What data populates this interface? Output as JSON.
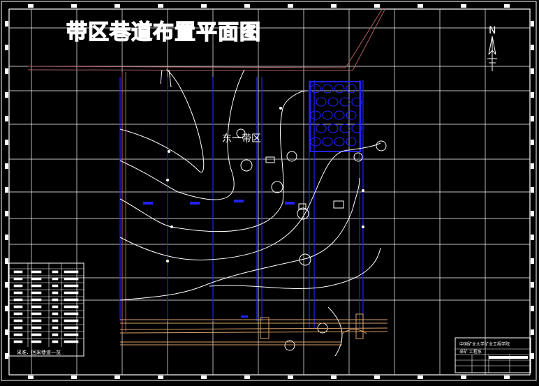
{
  "drawing": {
    "title": "带区巷道布置平面图",
    "zone_label": "东一带区",
    "north_label": "N"
  },
  "title_block": {
    "line1": "中国矿业大学矿业工程学院",
    "line2": "采矿 工程系"
  },
  "legend": {
    "caption": "采准、回采巷道一览"
  },
  "colors": {
    "background": "#000000",
    "grid": "#ffffff",
    "roadway": "#2222ff",
    "haulage": "#d9a066",
    "contour": "#ffffff",
    "boundary": "#b06060"
  }
}
